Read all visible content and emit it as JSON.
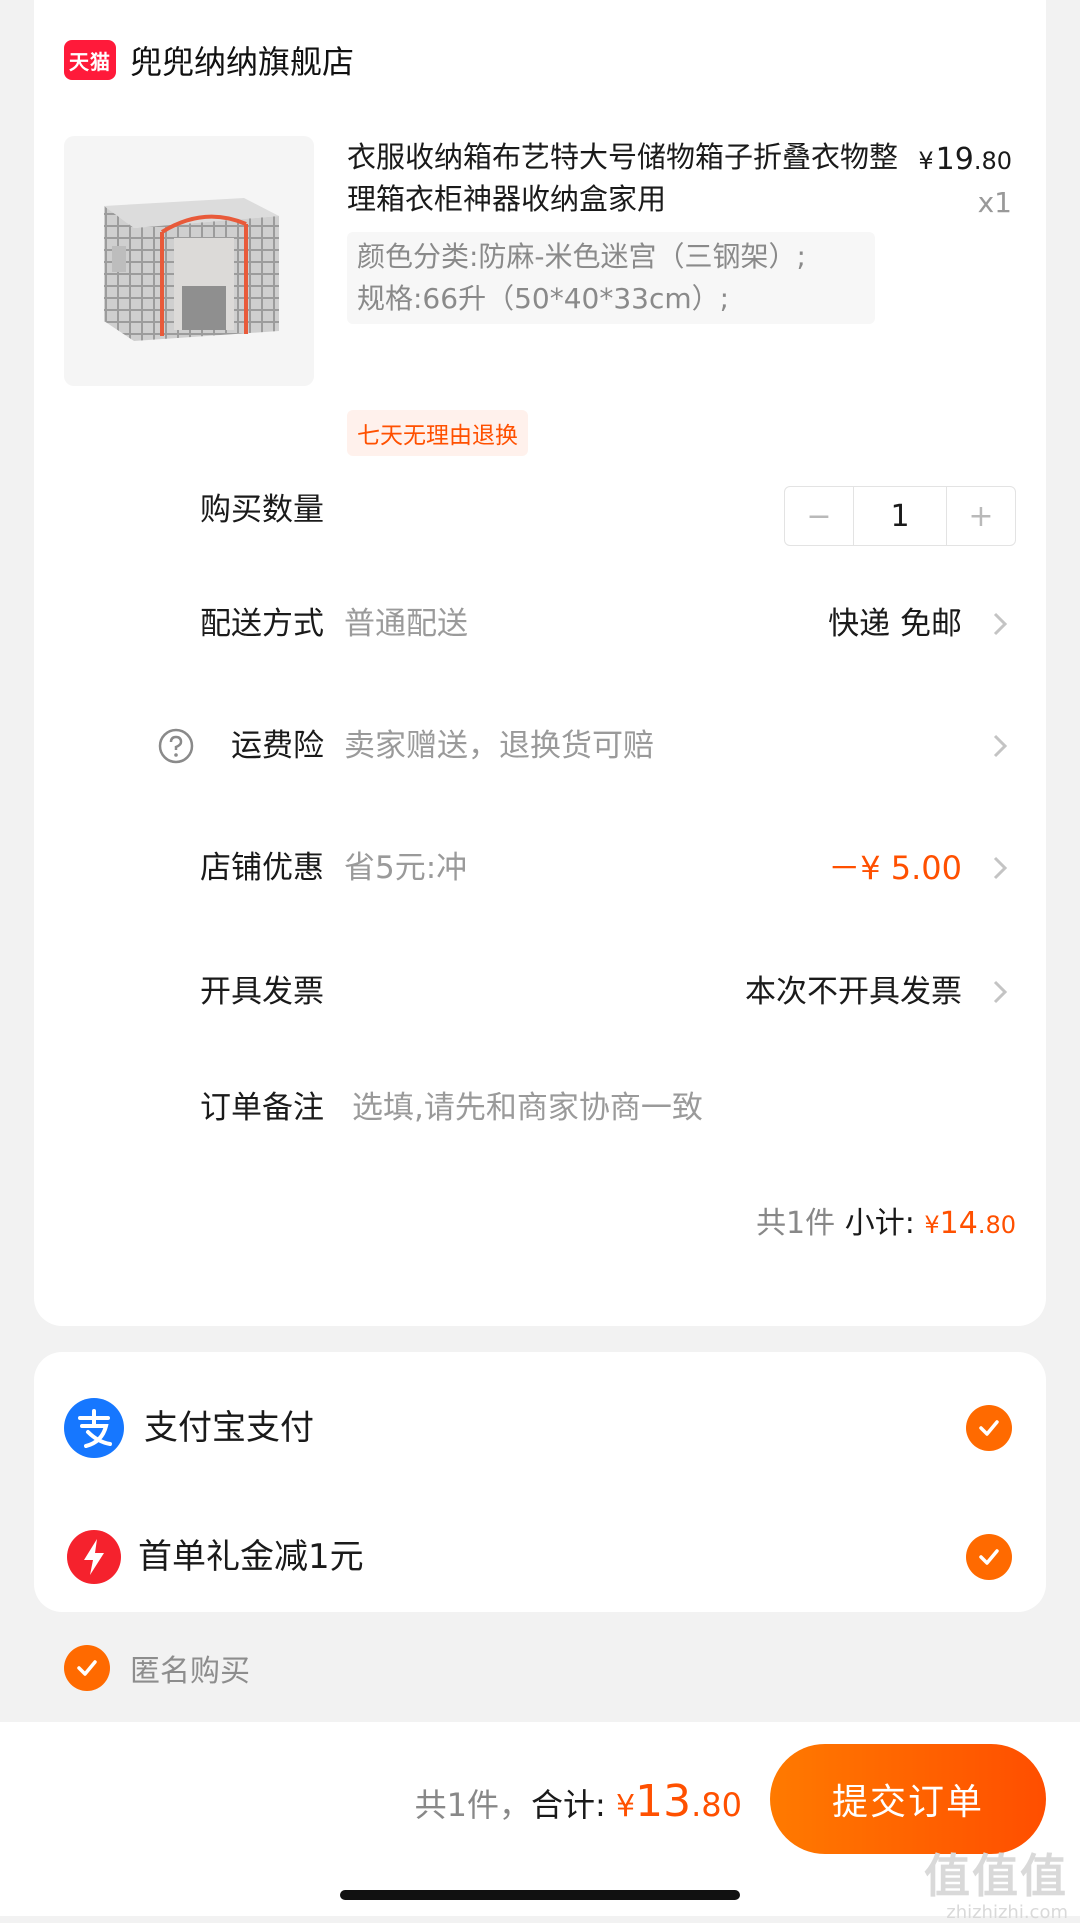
{
  "shop": {
    "logo_text": "天猫",
    "name": "兜兜纳纳旗舰店"
  },
  "product": {
    "title": "衣服收纳箱布艺特大号储物箱子折叠衣物整理箱衣柜神器收纳盒家用",
    "price_symbol": "¥",
    "price_int": "19",
    "price_dec": ".80",
    "quantity_label": "x1",
    "sku_line1": "颜色分类:防麻-米色迷宫（三钢架）;",
    "sku_line2": "规格:66升（50*40*33cm）;",
    "return_tag": "七天无理由退换",
    "image_icon": "storage-box-image"
  },
  "rows": {
    "quantity": {
      "label": "购买数量",
      "minus": "−",
      "value": "1",
      "plus": "+"
    },
    "delivery": {
      "label": "配送方式",
      "value": "普通配送",
      "right": "快递 免邮"
    },
    "insurance": {
      "label": "运费险",
      "value": "卖家赠送，退换货可赔",
      "icon": "help-icon"
    },
    "discount": {
      "label": "店铺优惠",
      "value": "省5元:冲",
      "right": "－¥ 5.00"
    },
    "invoice": {
      "label": "开具发票",
      "right": "本次不开具发票"
    },
    "note": {
      "label": "订单备注",
      "placeholder": "选填,请先和商家协商一致"
    }
  },
  "subtotal": {
    "count": "共1件",
    "label": "小计:",
    "symbol": "¥",
    "int": "14",
    "dec": ".80"
  },
  "payment": {
    "alipay_label": "支付宝支付",
    "alipay_icon": "alipay-icon",
    "coupon_label": "首单礼金减1元",
    "coupon_icon": "lightning-icon"
  },
  "anonymous": {
    "label": "匿名购买"
  },
  "footer": {
    "count": "共1件，",
    "label": "合计:",
    "symbol": "¥",
    "int": "13",
    "dec": ".80",
    "submit_label": "提交订单"
  },
  "watermark": {
    "logo": "值值值",
    "url": "zhizhizhi.com"
  },
  "colors": {
    "accent": "#ff5000",
    "tmall_red": "#ff1a3a",
    "alipay_blue": "#1677ff",
    "coupon_red": "#f5222d",
    "check_orange": "#ff6a00"
  }
}
